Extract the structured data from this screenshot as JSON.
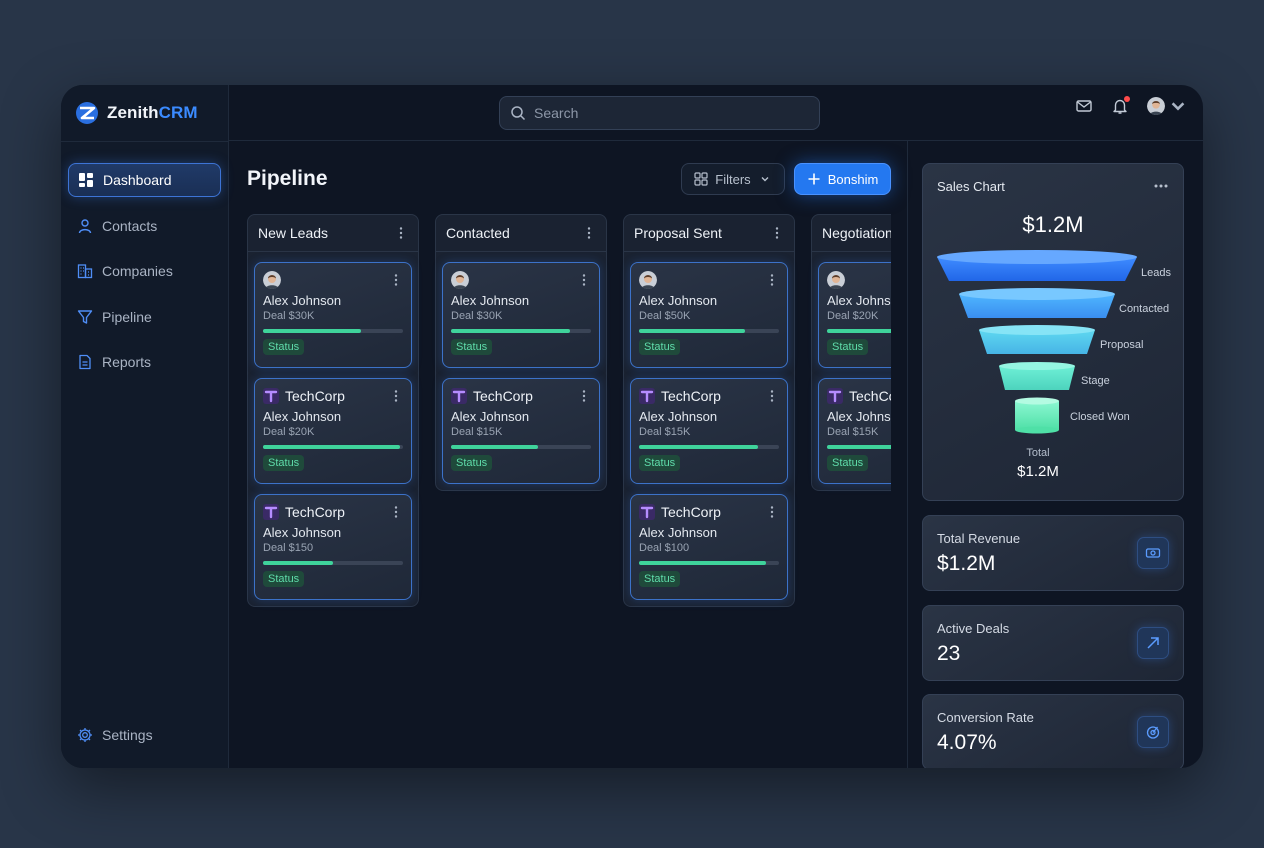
{
  "brand": {
    "name_main": "Zenith",
    "name_accent": "CRM"
  },
  "sidebar": {
    "items": [
      {
        "label": "Dashboard",
        "icon": "dashboard-icon",
        "active": true
      },
      {
        "label": "Contacts",
        "icon": "user-icon"
      },
      {
        "label": "Companies",
        "icon": "building-icon"
      },
      {
        "label": "Pipeline",
        "icon": "funnel-icon"
      },
      {
        "label": "Reports",
        "icon": "document-icon"
      }
    ],
    "settings_label": "Settings"
  },
  "search": {
    "placeholder": "Search"
  },
  "page": {
    "title": "Pipeline"
  },
  "toolbar": {
    "filters_label": "Filters",
    "add_label": "Bonshim"
  },
  "columns": [
    {
      "title": "New Leads",
      "cards": [
        {
          "kind": "person",
          "person": "Alex Johnson",
          "deal": "Deal $30K",
          "progress": 0.7,
          "status": "Status"
        },
        {
          "kind": "company",
          "company": "TechCorp",
          "person": "Alex Johnson",
          "deal": "Deal $20K",
          "progress": 0.98,
          "status": "Status"
        },
        {
          "kind": "company",
          "company": "TechCorp",
          "person": "Alex Johnson",
          "deal": "Deal $150",
          "progress": 0.5,
          "status": "Status"
        }
      ]
    },
    {
      "title": "Contacted",
      "cards": [
        {
          "kind": "person",
          "person": "Alex Johnson",
          "deal": "Deal $30K",
          "progress": 0.85,
          "status": "Status"
        },
        {
          "kind": "company",
          "company": "TechCorp",
          "person": "Alex Johnson",
          "deal": "Deal $15K",
          "progress": 0.62,
          "status": "Status"
        }
      ]
    },
    {
      "title": "Proposal Sent",
      "cards": [
        {
          "kind": "person",
          "person": "Alex Johnson",
          "deal": "Deal $50K",
          "progress": 0.76,
          "status": "Status"
        },
        {
          "kind": "company",
          "company": "TechCorp",
          "person": "Alex Johnson",
          "deal": "Deal $15K",
          "progress": 0.85,
          "status": "Status"
        },
        {
          "kind": "company",
          "company": "TechCorp",
          "person": "Alex Johnson",
          "deal": "Deal $100",
          "progress": 0.91,
          "status": "Status"
        }
      ]
    },
    {
      "title": "Negotiation",
      "cards": [
        {
          "kind": "person",
          "person": "Alex Johnson",
          "deal": "Deal $20K",
          "progress": 0.7,
          "status": "Status"
        },
        {
          "kind": "company",
          "company": "TechCorp",
          "person": "Alex Johnson",
          "deal": "Deal $15K",
          "progress": 0.6,
          "status": "Status"
        }
      ]
    }
  ],
  "sales_chart": {
    "title": "Sales Chart",
    "total": "$1.2M",
    "stages": [
      "Leads",
      "Contacted",
      "Proposal",
      "Stage",
      "Closed Won"
    ],
    "total_label": "Total",
    "total_value": "$1.2M"
  },
  "stats": [
    {
      "label": "Total Revenue",
      "value": "$1.2M",
      "icon": "money-icon"
    },
    {
      "label": "Active Deals",
      "value": "23",
      "icon": "trend-arrow-icon"
    },
    {
      "label": "Conversion Rate",
      "value": "4.07%",
      "icon": "target-icon"
    }
  ],
  "colors": {
    "accent": "#2478f0",
    "progress": "#3fd39b",
    "background": "#0e1523"
  }
}
